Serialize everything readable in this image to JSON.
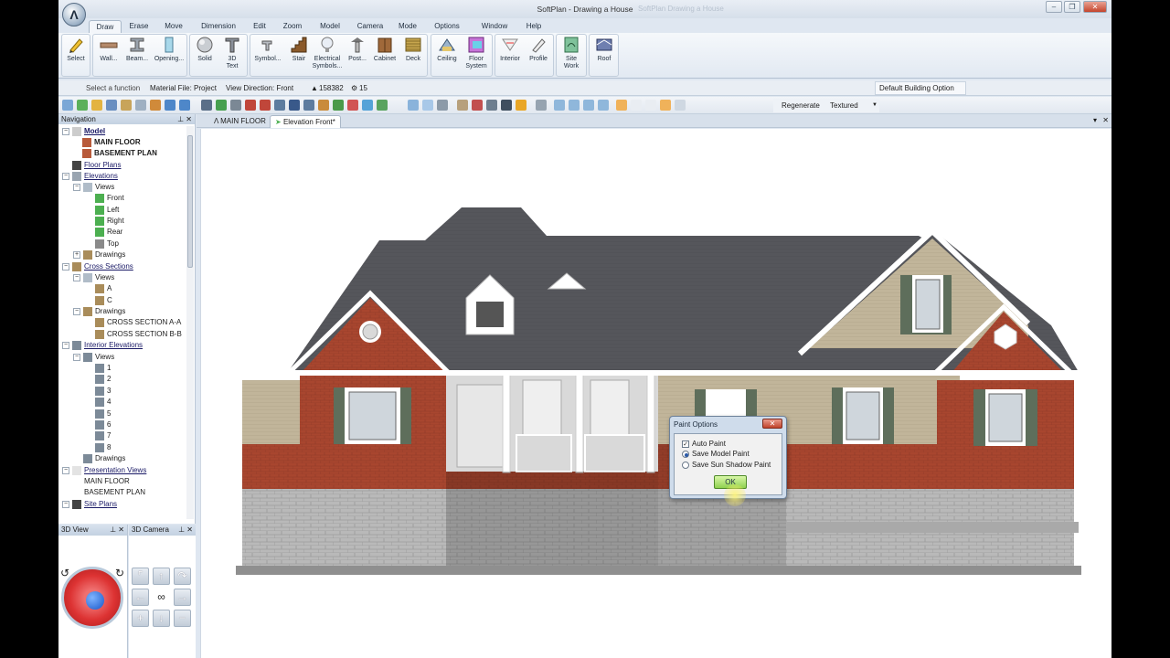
{
  "window": {
    "title": "SoftPlan - Drawing a House",
    "blurred_title": "SoftPlan Drawing a House"
  },
  "menu": {
    "tabs": [
      "Draw",
      "Erase",
      "Move",
      "Dimension",
      "Edit",
      "Zoom",
      "Model",
      "Camera",
      "Mode",
      "Options",
      "Window",
      "Help"
    ],
    "active": "Draw"
  },
  "ribbon": {
    "select": "Select",
    "wall": "Wall...",
    "beam": "Beam...",
    "opening": "Opening...",
    "solid": "Solid",
    "text3d_a": "3D",
    "text3d_b": "Text",
    "symbol": "Symbol...",
    "stair": "Stair",
    "electrical_a": "Electrical",
    "electrical_b": "Symbols...",
    "post": "Post...",
    "cabinet": "Cabinet",
    "deck": "Deck",
    "ceiling": "Ceiling",
    "floor_a": "Floor",
    "floor_b": "System",
    "interior": "Interior",
    "profile": "Profile",
    "sitework_a": "Site",
    "sitework_b": "Work",
    "roof": "Roof"
  },
  "status": {
    "function": "Select a function",
    "material": "Material File: Project",
    "view_direction": "View Direction: Front",
    "count_a": "158382",
    "count_b": "15",
    "building_option": "Default Building Option",
    "regenerate": "Regenerate",
    "render_mode": "Textured"
  },
  "nav": {
    "header": "Navigation",
    "items": {
      "model": "Model",
      "main_floor": "MAIN FLOOR",
      "basement_plan": "BASEMENT PLAN",
      "floor_plans": "Floor Plans",
      "elevations": "Elevations",
      "views": "Views",
      "front": "Front",
      "left": "Left",
      "right": "Right",
      "rear": "Rear",
      "top": "Top",
      "drawings": "Drawings",
      "cross_sections": "Cross Sections",
      "a": "A",
      "c": "C",
      "cs_aa": "CROSS SECTION A-A",
      "cs_bb": "CROSS SECTION B-B",
      "interior_elevations": "Interior Elevations",
      "n1": "1",
      "n2": "2",
      "n3": "3",
      "n4": "4",
      "n5": "5",
      "n6": "6",
      "n7": "7",
      "n8": "8",
      "presentation_views": "Presentation Views",
      "pv_main": "MAIN FLOOR",
      "pv_basement": "BASEMENT PLAN",
      "site_plans": "Site Plans"
    }
  },
  "panels": {
    "view3d": "3D View",
    "camera3d": "3D Camera"
  },
  "doc_tabs": {
    "tab1": "MAIN FLOOR",
    "tab2": "Elevation Front*"
  },
  "dialog": {
    "title": "Paint Options",
    "auto_paint": "Auto Paint",
    "save_model_paint": "Save Model Paint",
    "save_sun_shadow": "Save Sun Shadow Paint",
    "ok": "OK",
    "auto_paint_checked": true,
    "selected_option": "Save Model Paint"
  },
  "colors": {
    "brick": "#a8462f",
    "roof": "#55565b",
    "siding": "#c1b59a",
    "stone": "#b8b8b8",
    "shutter": "#5e6e5b",
    "trim": "#ffffff"
  }
}
